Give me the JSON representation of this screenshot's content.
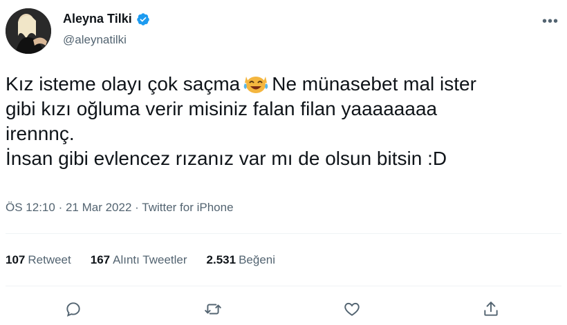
{
  "author": {
    "name": "Aleyna Tilki",
    "handle": "@aleynatilki",
    "verified_icon": "verified-badge-icon",
    "verified_color": "#1d9bf0"
  },
  "menu": {
    "more_label": "•••"
  },
  "tweet": {
    "line1_start": "Kız isteme olayı çok saçma",
    "emoji": "face-with-tears-of-joy-cat",
    "line1_end": "Ne münasebet mal ister",
    "line2": "gibi kızı oğluma verir misiniz falan filan yaaaaaaaa",
    "line3": "irennnç.",
    "line4": "İnsan gibi evlencez rızanız var mı de olsun bitsin :D"
  },
  "meta": {
    "time": "ÖS 12:10",
    "date": "21 Mar 2022",
    "separator": "·",
    "source": "Twitter for iPhone"
  },
  "stats": {
    "retweets_count": "107",
    "retweets_label": "Retweet",
    "quotes_count": "167",
    "quotes_label": "Alıntı Tweetler",
    "likes_count": "2.531",
    "likes_label": "Beğeni"
  },
  "actions": [
    "reply-icon",
    "retweet-icon",
    "like-icon",
    "share-icon"
  ],
  "colors": {
    "text": "#0f1419",
    "muted": "#536471",
    "divider": "#eff3f4"
  }
}
